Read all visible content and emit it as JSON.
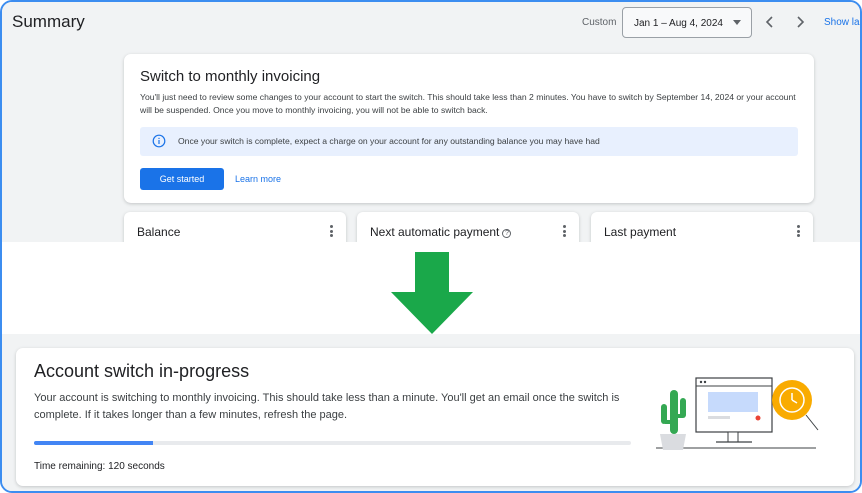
{
  "top": {
    "title": "Summary",
    "custom_label": "Custom",
    "date_range": "Jan 1 – Aug 4, 2024",
    "show_link": "Show la"
  },
  "invoice_card": {
    "title": "Switch to monthly invoicing",
    "body": "You'll just need to review some changes to your account to start the switch. This should take less than 2 minutes. You have to switch by September 14, 2024 or your account will be suspended. Once you move to monthly invoicing, you will not be able to switch back.",
    "info": "Once your switch is complete, expect a charge on your account for any outstanding balance you may have had",
    "primary_button": "Get started",
    "secondary_link": "Learn more"
  },
  "mini_cards": [
    {
      "title": "Balance"
    },
    {
      "title": "Next automatic payment"
    },
    {
      "title": "Last payment"
    }
  ],
  "progress_card": {
    "title": "Account switch in-progress",
    "body": "Your account is switching to monthly invoicing. This should take less than a minute. You'll get an email once the switch is complete. If it takes longer than a few minutes, refresh the page.",
    "progress_fraction": 0.2,
    "time_remaining": "Time remaining: 120 seconds"
  },
  "colors": {
    "accent_blue": "#1a73e8",
    "arrow_green": "#1aa84a",
    "coin_yellow": "#f9ab00",
    "plant_green": "#34a853"
  },
  "icons": [
    "info-icon",
    "chevron-left-icon",
    "chevron-right-icon",
    "caret-down-icon",
    "more-vert-icon",
    "help-icon",
    "down-arrow-icon"
  ]
}
